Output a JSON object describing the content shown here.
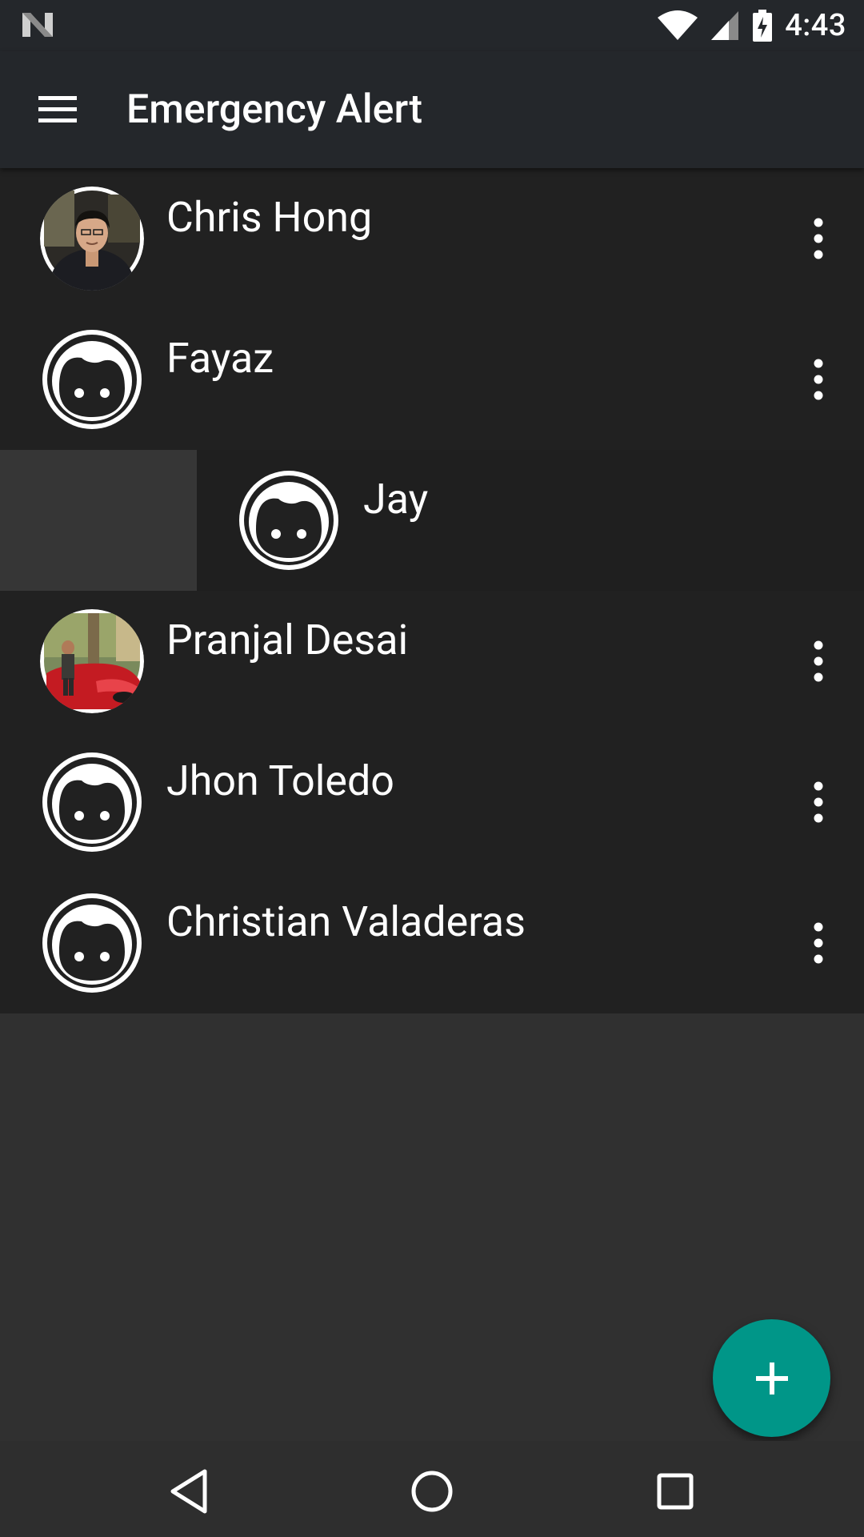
{
  "status_bar": {
    "time": "4:43",
    "icons": [
      "notification-n-icon",
      "wifi-icon",
      "cellular-signal-icon",
      "battery-charging-icon"
    ]
  },
  "app_bar": {
    "title": "Emergency Alert",
    "menu_icon": "hamburger-menu-icon"
  },
  "contacts": [
    {
      "name": "Chris Hong",
      "avatar": "photo",
      "menu_icon": "more-vert-icon"
    },
    {
      "name": "Fayaz",
      "avatar": "default-face-icon",
      "menu_icon": "more-vert-icon"
    },
    {
      "name": "Jay",
      "avatar": "default-face-icon",
      "state": "swiping"
    },
    {
      "name": "Pranjal Desai",
      "avatar": "photo",
      "menu_icon": "more-vert-icon"
    },
    {
      "name": "Jhon Toledo",
      "avatar": "default-face-icon",
      "menu_icon": "more-vert-icon"
    },
    {
      "name": "Christian Valaderas",
      "avatar": "default-face-icon",
      "menu_icon": "more-vert-icon"
    }
  ],
  "fab": {
    "icon": "add-icon"
  },
  "nav_bar": {
    "icons": [
      "back-icon",
      "home-icon",
      "recents-icon"
    ]
  },
  "colors": {
    "app_bar": "#24272b",
    "list_background": "#212121",
    "page_background": "#303030",
    "fab": "#009688",
    "text": "#ffffff"
  }
}
